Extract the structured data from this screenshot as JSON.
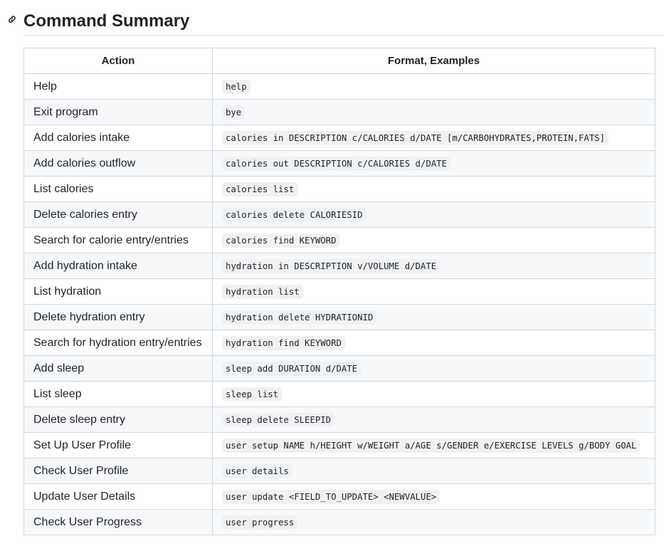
{
  "heading": {
    "title": "Command Summary",
    "anchor_icon": "link-icon"
  },
  "table": {
    "headers": {
      "action": "Action",
      "format": "Format, Examples"
    },
    "rows": [
      {
        "action": "Help",
        "format": "help"
      },
      {
        "action": "Exit program",
        "format": "bye"
      },
      {
        "action": "Add calories intake",
        "format": "calories in DESCRIPTION c/CALORIES d/DATE [m/CARBOHYDRATES,PROTEIN,FATS]"
      },
      {
        "action": "Add calories outflow",
        "format": "calories out DESCRIPTION c/CALORIES d/DATE"
      },
      {
        "action": "List calories",
        "format": "calories list"
      },
      {
        "action": "Delete calories entry",
        "format": "calories delete CALORIESID"
      },
      {
        "action": "Search for calorie entry/entries",
        "format": "calories find KEYWORD"
      },
      {
        "action": "Add hydration intake",
        "format": "hydration in DESCRIPTION v/VOLUME d/DATE"
      },
      {
        "action": "List hydration",
        "format": "hydration list"
      },
      {
        "action": "Delete hydration entry",
        "format": "hydration delete HYDRATIONID"
      },
      {
        "action": "Search for hydration entry/entries",
        "format": "hydration find KEYWORD"
      },
      {
        "action": "Add sleep",
        "format": "sleep add DURATION d/DATE"
      },
      {
        "action": "List sleep",
        "format": "sleep list"
      },
      {
        "action": "Delete sleep entry",
        "format": "sleep delete SLEEPID"
      },
      {
        "action": "Set Up User Profile",
        "format": "user setup NAME h/HEIGHT w/WEIGHT a/AGE s/GENDER e/EXERCISE LEVELS g/BODY GOAL"
      },
      {
        "action": "Check User Profile",
        "format": "user details"
      },
      {
        "action": "Update User Details",
        "format": "user update <FIELD_TO_UPDATE> <NEWVALUE>"
      },
      {
        "action": "Check User Progress",
        "format": "user progress"
      }
    ]
  },
  "colors": {
    "text": "#1f2328",
    "border": "#d1d9e0",
    "stripe": "#f6f8fa",
    "code_bg": "#eff1f3"
  }
}
